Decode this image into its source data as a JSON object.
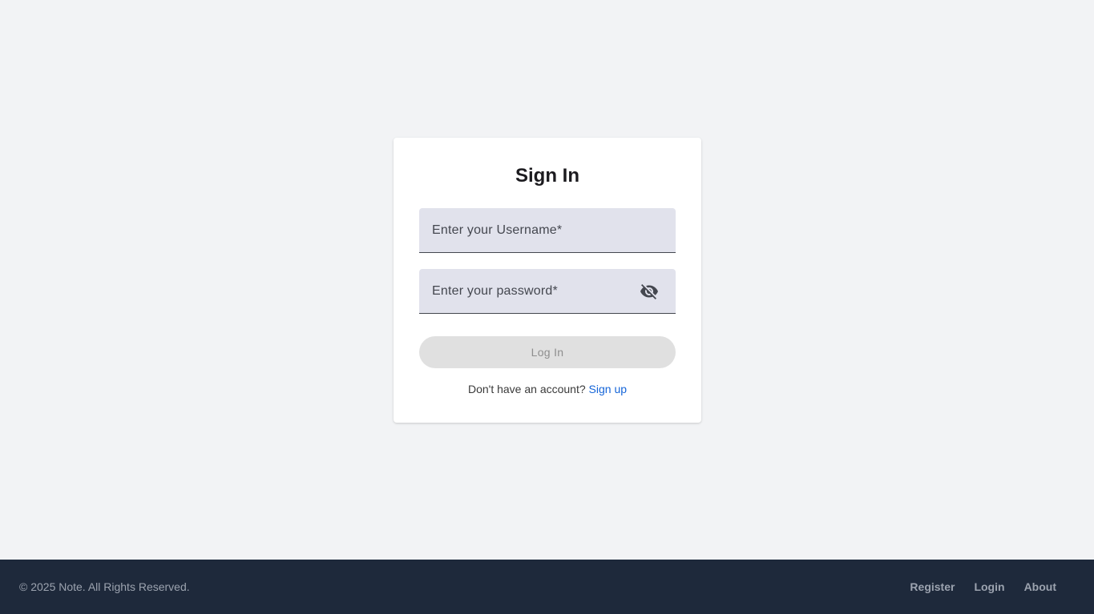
{
  "signin": {
    "title": "Sign In",
    "username_label": "Enter your Username*",
    "password_label": "Enter your password*",
    "visibility_icon": "visibility-off-icon",
    "login_label": "Log In",
    "no_account_text": "Don't have an account?",
    "signup_label": "Sign up"
  },
  "footer": {
    "copyright": "© 2025 Note. All Rights Reserved.",
    "links": [
      {
        "label": "Register"
      },
      {
        "label": "Login"
      },
      {
        "label": "About"
      }
    ]
  },
  "colors": {
    "background": "#f2f3f5",
    "card": "#ffffff",
    "field": "#e1e2ec",
    "link": "#1565d8",
    "footer": "#1e293b",
    "footer_text": "#9ca3af",
    "button_disabled": "#e0e0e0"
  }
}
